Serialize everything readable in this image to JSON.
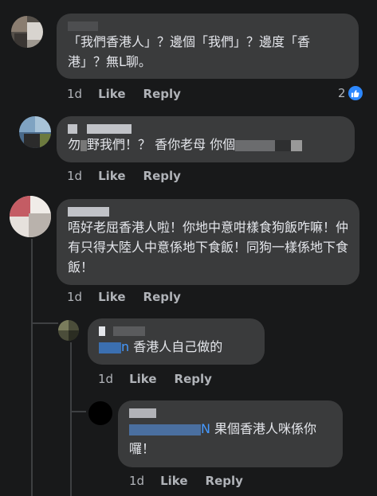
{
  "comments": [
    {
      "text": "「我們香港人」？邊個「我們」？邊度「香港」？無L聊。",
      "time": "1d",
      "like_label": "Like",
      "reply_label": "Reply",
      "reaction_count": "2",
      "reaction_icon": "like-icon"
    },
    {
      "text_parts": [
        "勿",
        "野我們！？ 香你老母 你個"
      ],
      "time": "1d",
      "like_label": "Like",
      "reply_label": "Reply"
    },
    {
      "text": "唔好老屈香港人啦！你地中意咁樣食狗飯咋嘛！仲有只得大陸人中意係地下食飯！同狗一樣係地下食飯！",
      "time": "1d",
      "like_label": "Like",
      "reply_label": "Reply"
    },
    {
      "mention": "n",
      "text": " 香港人自己做的",
      "time": "1d",
      "like_label": "Like",
      "reply_label": "Reply"
    },
    {
      "mention": "N",
      "text": " 果個香港人咪係你囉！",
      "time": "1d",
      "like_label": "Like",
      "reply_label": "Reply"
    }
  ],
  "colors": {
    "background": "#18191a",
    "bubble": "#3a3b3c",
    "text": "#e4e6eb",
    "meta": "#b0b3b8",
    "mention": "#4599ff",
    "like_badge": "#2d88ff"
  }
}
